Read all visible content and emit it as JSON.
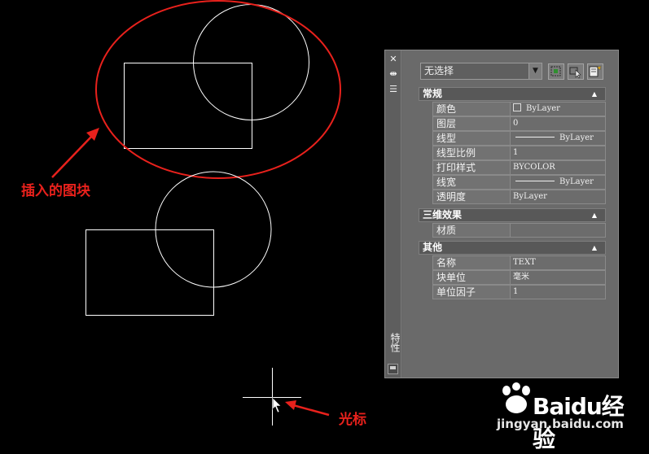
{
  "annotations": {
    "block_label": "插入的图块",
    "cursor_label": "光标"
  },
  "watermark": {
    "brand_text": "Baidu经验",
    "url": "jingyan.baidu.com"
  },
  "palette": {
    "title": "特性",
    "selector": {
      "value": "无选择"
    },
    "toolbar": [
      "toggle-pickadd-icon",
      "select-objects-icon",
      "quick-select-icon"
    ],
    "sections": [
      {
        "title": "常规",
        "rows": [
          {
            "name": "颜色",
            "value": "ByLayer",
            "preview": "swatch"
          },
          {
            "name": "图层",
            "value": "0"
          },
          {
            "name": "线型",
            "value": "ByLayer",
            "preview": "line"
          },
          {
            "name": "线型比例",
            "value": "1"
          },
          {
            "name": "打印样式",
            "value": "BYCOLOR"
          },
          {
            "name": "线宽",
            "value": "ByLayer",
            "preview": "line"
          },
          {
            "name": "透明度",
            "value": "ByLayer"
          }
        ]
      },
      {
        "title": "三维效果",
        "rows": [
          {
            "name": "材质",
            "value": ""
          }
        ]
      },
      {
        "title": "其他",
        "rows": [
          {
            "name": "名称",
            "value": "TEXT"
          },
          {
            "name": "块单位",
            "value": "毫米"
          },
          {
            "name": "单位因子",
            "value": "1"
          }
        ]
      }
    ]
  },
  "colors": {
    "annotation_red": "#e8211c",
    "geometry": "#ffffff",
    "canvas_bg": "#000000"
  }
}
